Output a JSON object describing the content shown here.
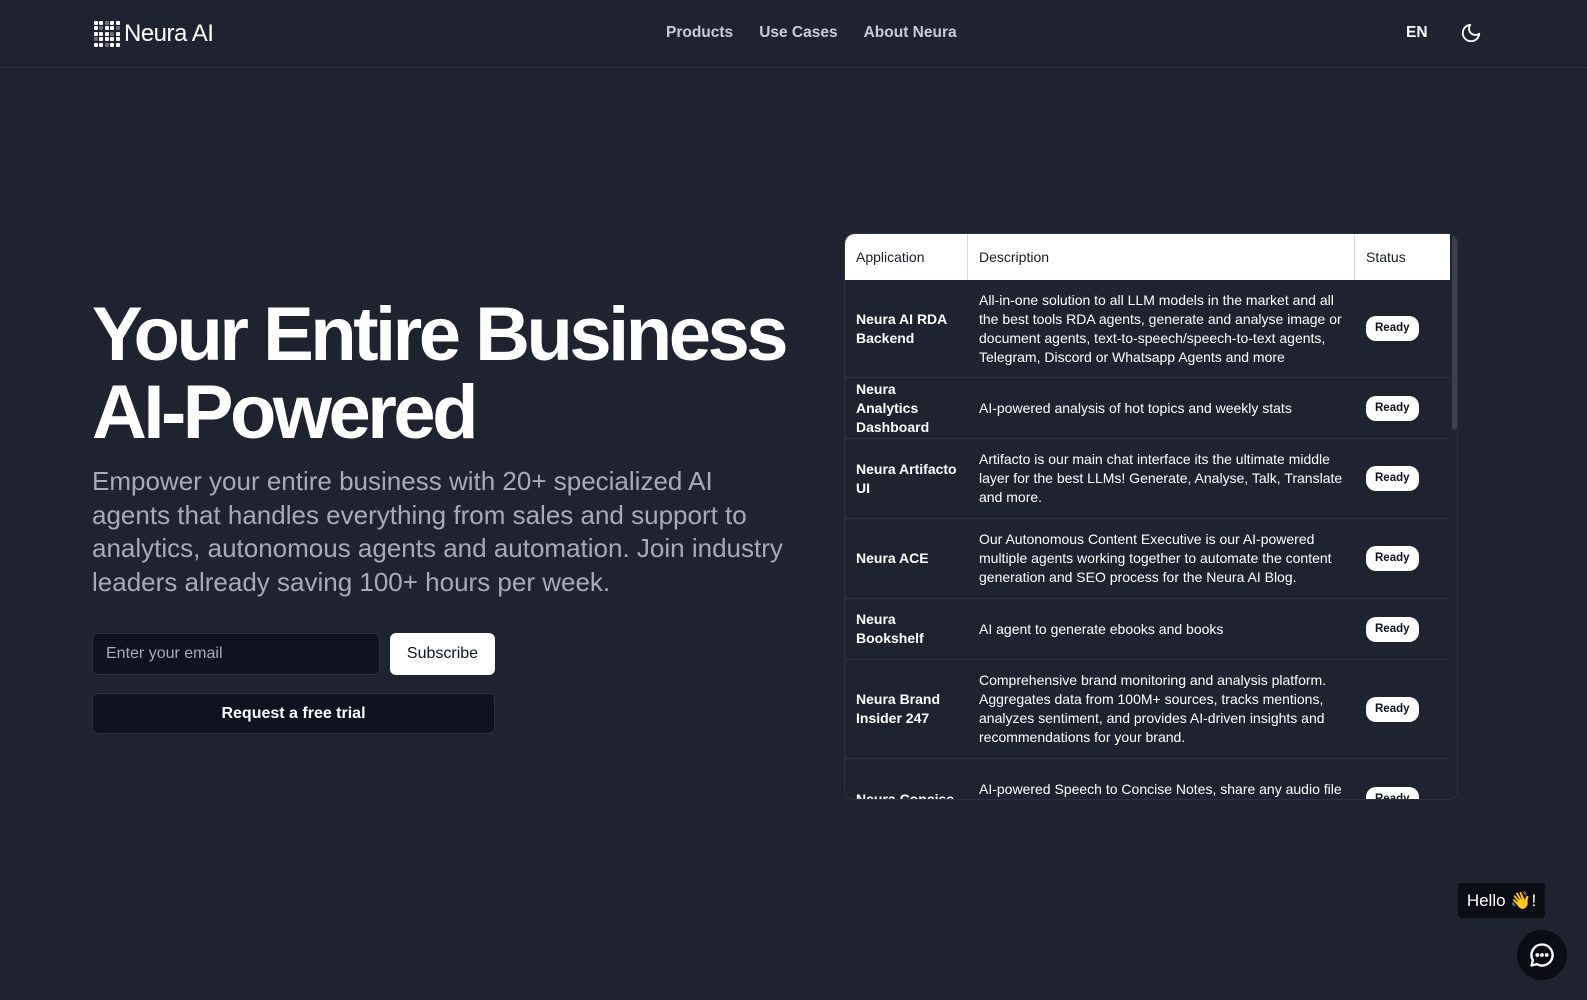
{
  "header": {
    "logo_text": "Neura AI",
    "nav": [
      "Products",
      "Use Cases",
      "About Neura"
    ],
    "language": "EN"
  },
  "hero": {
    "title_line1": "Your Entire Business",
    "title_line2": "AI-Powered",
    "subtitle": "Empower your entire business with 20+ specialized AI agents that handles everything from sales and support to analytics, autonomous agents and automation. Join industry leaders already saving 100+ hours per week.",
    "email_placeholder": "Enter your email",
    "subscribe_label": "Subscribe",
    "trial_label": "Request a free trial"
  },
  "table": {
    "headers": [
      "Application",
      "Description",
      "Status"
    ],
    "rows": [
      {
        "app": "Neura AI RDA Backend",
        "desc": "All-in-one solution to all LLM models in the market and all the best tools RDA agents, generate and analyse image or document agents, text-to-speech/speech-to-text agents, Telegram, Discord or Whatsapp Agents and more",
        "status": "Ready"
      },
      {
        "app": "Neura Analytics Dashboard",
        "desc": "AI-powered analysis of hot topics and weekly stats",
        "status": "Ready"
      },
      {
        "app": "Neura Artifacto UI",
        "desc": "Artifacto is our main chat interface its the ultimate middle layer for the best LLMs! Generate, Analyse, Talk, Translate and more.",
        "status": "Ready"
      },
      {
        "app": "Neura ACE",
        "desc": "Our Autonomous Content Executive is our AI-powered multiple agents working together to automate the content generation and SEO process for the Neura AI Blog.",
        "status": "Ready"
      },
      {
        "app": "Neura Bookshelf",
        "desc": "AI agent to generate ebooks and books",
        "status": "Ready"
      },
      {
        "app": "Neura Brand Insider 247",
        "desc": "Comprehensive brand monitoring and analysis platform. Aggregates data from 100M+ sources, tracks mentions, analyzes sentiment, and provides AI-driven insights and recommendations for your brand.",
        "status": "Ready"
      },
      {
        "app": "Neura Concise",
        "desc": "AI-powered Speech to Concise Notes, share any audio file and Neura summarize it concisely",
        "status": "Ready"
      }
    ]
  },
  "chat": {
    "greeting": "Hello 👋!"
  },
  "icons": {
    "theme": "moon-icon",
    "chat": "chat-bubble-icon"
  }
}
